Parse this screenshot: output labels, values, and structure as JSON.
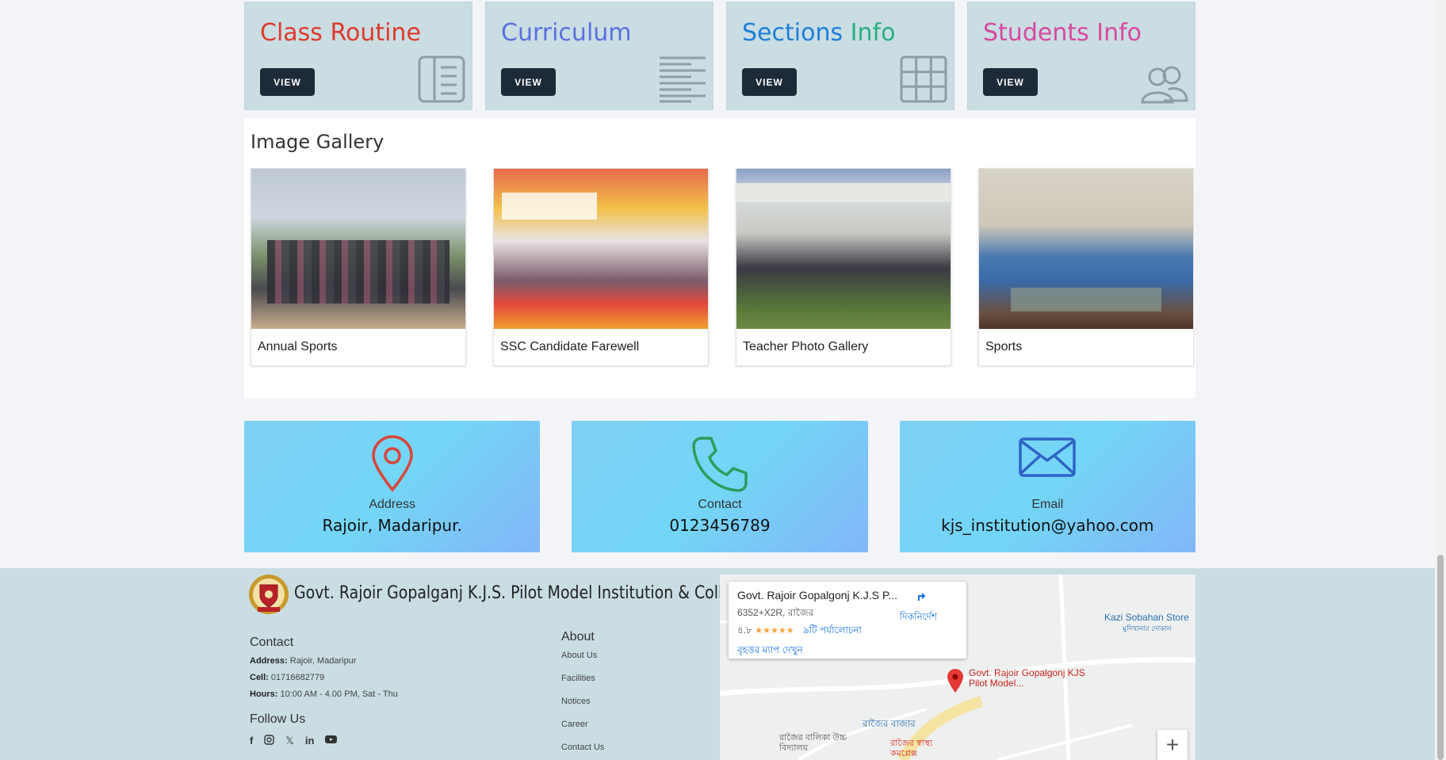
{
  "info_cards": [
    {
      "title": "Class Routine",
      "color": "#e0392b",
      "button": "VIEW",
      "icon": "list-panel-icon"
    },
    {
      "title": "Curriculum",
      "color": "#5b6fe0",
      "button": "VIEW",
      "icon": "text-lines-icon"
    },
    {
      "title": "Sections Info",
      "colors": [
        "#1e7fd8",
        "#27b07d"
      ],
      "title_parts": [
        "Sections ",
        "Info"
      ],
      "button": "VIEW",
      "icon": "grid-table-icon"
    },
    {
      "title": "Students Info",
      "color": "#d8489e",
      "button": "VIEW",
      "icon": "users-icon"
    }
  ],
  "gallery": {
    "heading": "Image Gallery",
    "items": [
      {
        "caption": "Annual Sports"
      },
      {
        "caption": "SSC Candidate Farewell"
      },
      {
        "caption": "Teacher Photo Gallery"
      },
      {
        "caption": "Sports"
      }
    ]
  },
  "contact_tiles": [
    {
      "label": "Address",
      "value": "Rajoir, Madaripur.",
      "icon": "map-pin-icon",
      "icon_color": "#d9453a"
    },
    {
      "label": "Contact",
      "value": "0123456789",
      "icon": "phone-icon",
      "icon_color": "#2a9d5c"
    },
    {
      "label": "Email",
      "value": "kjs_institution@yahoo.com",
      "icon": "envelope-icon",
      "icon_color": "#2f63c7"
    }
  ],
  "footer": {
    "institution_name": "Govt. Rajoir Gopalganj K.J.S. Pilot Model Institution & College",
    "contact": {
      "heading": "Contact",
      "address_label": "Address:",
      "address": " Rajoir, Madaripur",
      "cell_label": "Cell:",
      "cell": " 01716682779",
      "hours_label": "Hours:",
      "hours": " 10:00 AM - 4.00 PM, Sat - Thu"
    },
    "follow": {
      "heading": "Follow Us",
      "icons": [
        "facebook-icon",
        "instagram-icon",
        "x-icon",
        "linkedin-icon",
        "youtube-icon"
      ]
    },
    "about": {
      "heading": "About",
      "links": [
        "About Us",
        "Facilities",
        "Notices",
        "Career",
        "Contact Us"
      ]
    }
  },
  "map": {
    "place_title": "Govt. Rajoir Gopalgonj K.J.S P...",
    "plus_code": "6352+X2R, রাজৈর",
    "rating": "৪.৮",
    "stars": "★★★★★",
    "reviews": "৯টি পর্যালোচনা",
    "directions": "দিকনির্দেশ",
    "larger_map": "বৃহত্তর ম্যাপ দেখুন",
    "marker_label": "Govt. Rajoir Gopalgonj KJS Pilot Model...",
    "poi_store": "Kazi Sobahan Store",
    "poi_store_sub": "মুদিখানার দোকান",
    "poi_bazar": "রাজৈর বাজার",
    "poi_school": "রাজৈর বালিকা উচ্চ বিদ্যালয়",
    "poi_health": "রাজৈর স্বাস্থ্য কমপ্লেক্স",
    "zoom_in": "+"
  }
}
